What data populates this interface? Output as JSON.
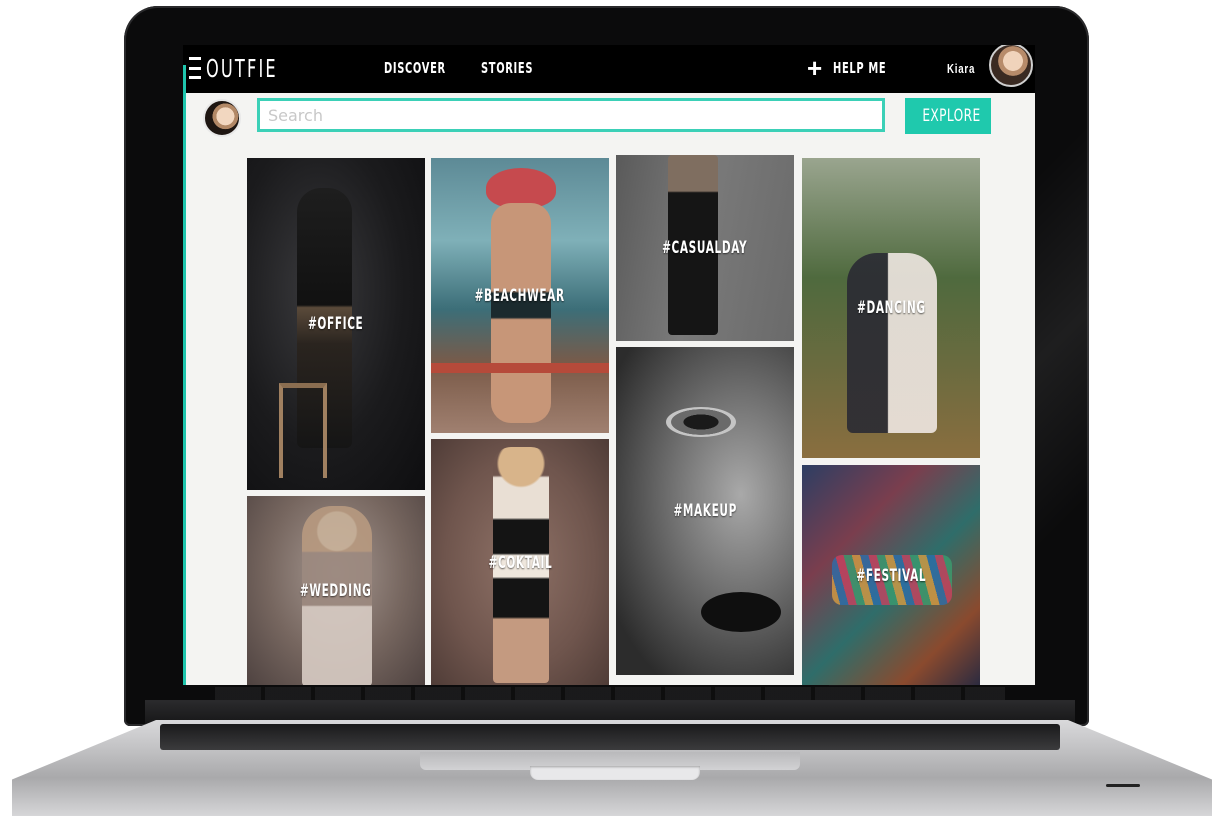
{
  "app": {
    "logo": "OUTFIE",
    "nav": [
      "DISCOVER",
      "STORIES"
    ],
    "help_label": "HELP ME",
    "user_name": "Kiara"
  },
  "search": {
    "placeholder": "Search",
    "button_label": "EXPLORE"
  },
  "tiles": [
    {
      "label": "#OFFICE"
    },
    {
      "label": "#BEACHWEAR"
    },
    {
      "label": "#CASUALDAY"
    },
    {
      "label": "#DANCING"
    },
    {
      "label": "#WEDDING"
    },
    {
      "label": "#COKTAIL"
    },
    {
      "label": "#MAKEUP"
    },
    {
      "label": "#FESTIVAL"
    }
  ],
  "colors": {
    "accent": "#1fc9ad",
    "topbar": "#000000",
    "screen_bg": "#f4f4f2"
  },
  "icons": [
    "menu-icon",
    "plus-icon",
    "user-avatar"
  ]
}
